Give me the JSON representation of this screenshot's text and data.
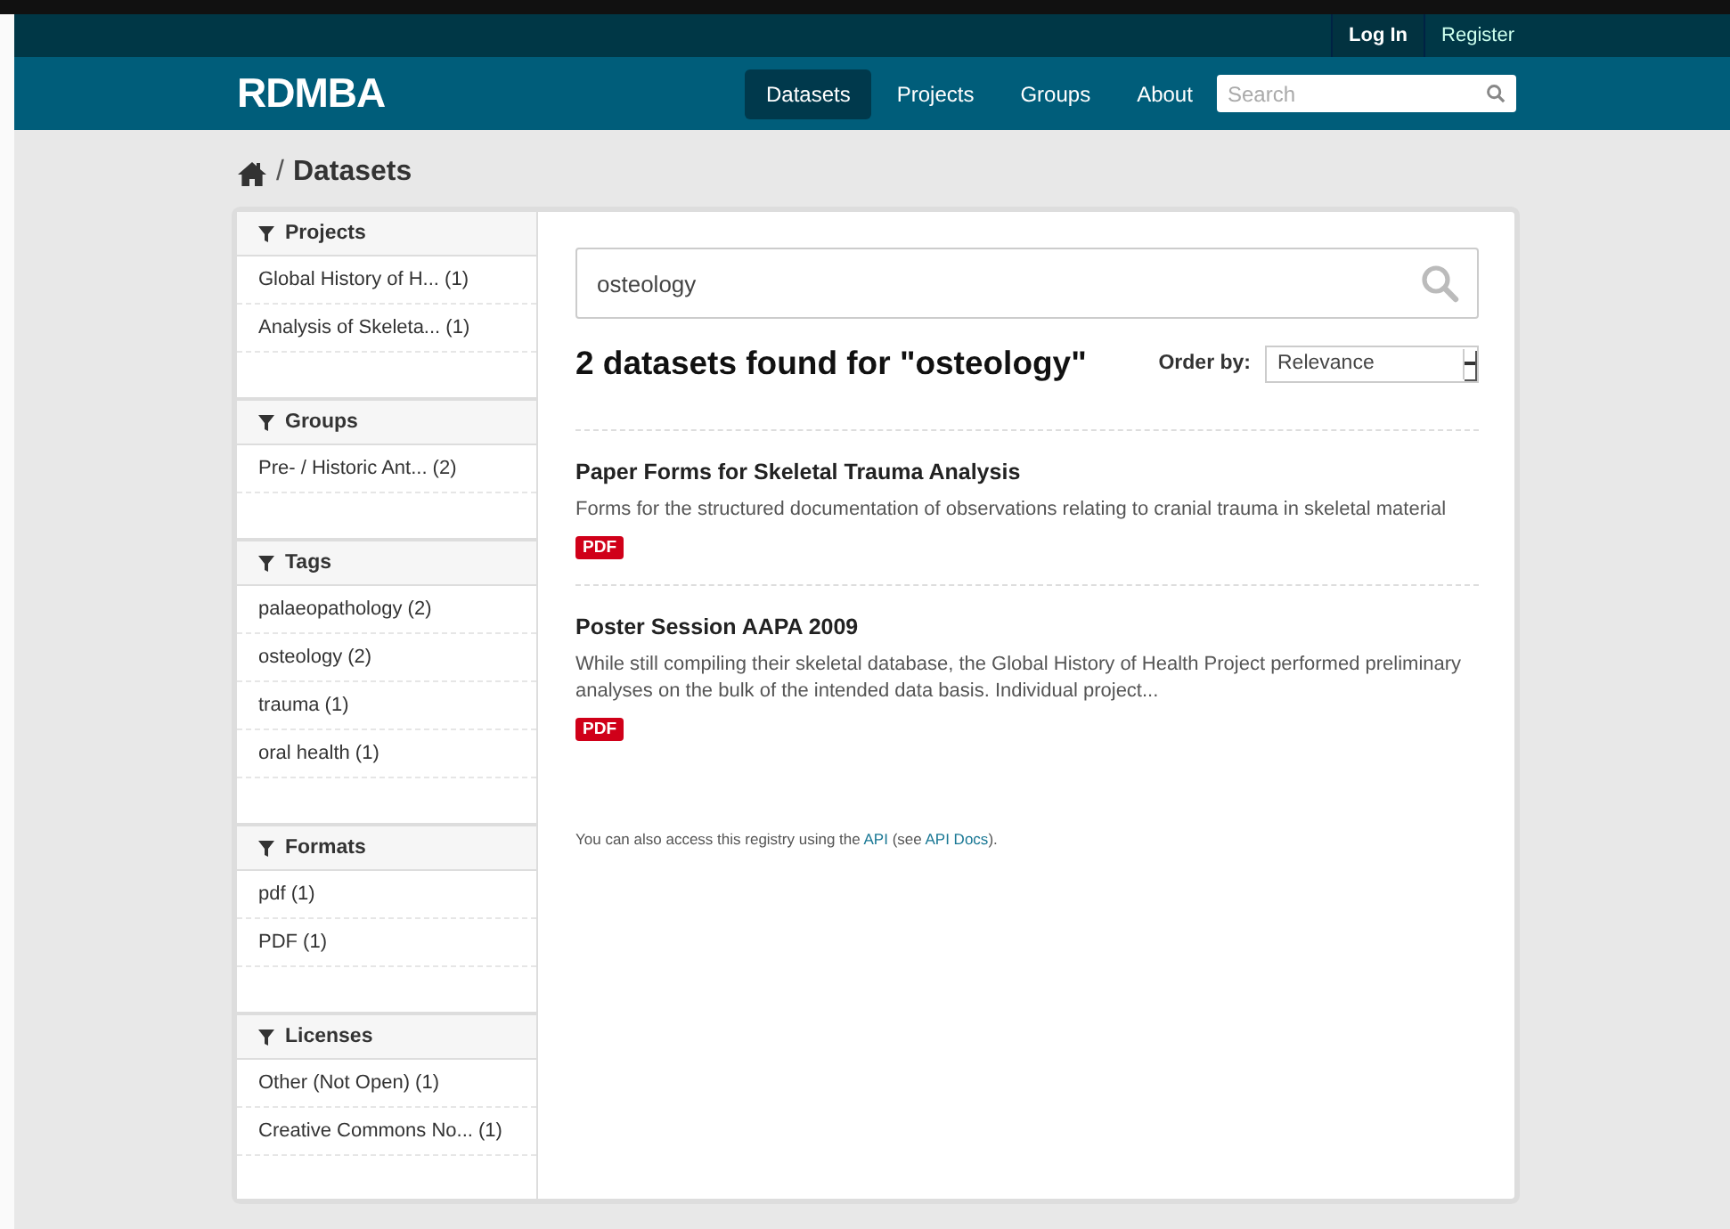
{
  "account_links": [
    {
      "label": "Log In",
      "selected": true
    },
    {
      "label": "Register",
      "selected": false
    }
  ],
  "site_title": "RDMBA",
  "nav": [
    {
      "label": "Datasets",
      "selected": true
    },
    {
      "label": "Projects",
      "selected": false
    },
    {
      "label": "Groups",
      "selected": false
    },
    {
      "label": "About",
      "selected": false
    }
  ],
  "header_search": {
    "placeholder": "Search"
  },
  "breadcrumb": {
    "separator": "/",
    "current": "Datasets"
  },
  "facets": [
    {
      "title": "Projects",
      "items": [
        "Global History of H... (1)",
        "Analysis of Skeleta... (1)"
      ]
    },
    {
      "title": "Groups",
      "items": [
        "Pre- / Historic Ant... (2)"
      ]
    },
    {
      "title": "Tags",
      "items": [
        "palaeopathology (2)",
        "osteology (2)",
        "trauma (1)",
        "oral health (1)"
      ]
    },
    {
      "title": "Formats",
      "items": [
        "pdf (1)",
        "PDF (1)"
      ]
    },
    {
      "title": "Licenses",
      "items": [
        "Other (Not Open) (1)",
        "Creative Commons No... (1)"
      ]
    }
  ],
  "search": {
    "value": "osteology"
  },
  "results_heading": "2 datasets found for \"osteology\"",
  "order_by": {
    "label": "Order by:",
    "value": "Relevance"
  },
  "datasets": [
    {
      "title": "Paper Forms for Skeletal Trauma Analysis",
      "description": "Forms for the structured documentation of observations relating to cranial trauma in skeletal material",
      "formats": [
        "PDF"
      ]
    },
    {
      "title": "Poster Session AAPA 2009",
      "description": "While still compiling their skeletal database, the Global History of Health Project performed preliminary analyses on the bulk of the intended data basis. Individual project...",
      "formats": [
        "PDF"
      ]
    }
  ],
  "api_note": {
    "before": "You can also access this registry using the ",
    "link": "API",
    "middle": " (see ",
    "link2": "API Docs",
    "after": ")."
  }
}
